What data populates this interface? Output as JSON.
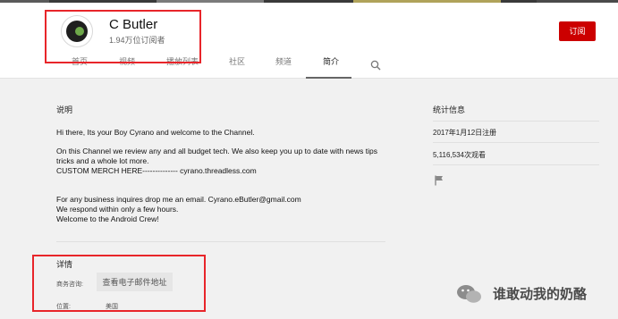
{
  "channel": {
    "name": "C Butler",
    "subscribers": "1.94万位订阅者",
    "subscribe_label": "订阅"
  },
  "tabs": [
    {
      "label": "首页"
    },
    {
      "label": "视频"
    },
    {
      "label": "播放列表"
    },
    {
      "label": "社区"
    },
    {
      "label": "频道"
    },
    {
      "label": "简介",
      "active": true
    }
  ],
  "about": {
    "title": "说明",
    "description": [
      "Hi there, Its your Boy Cyrano and welcome to the Channel.",
      "On this Channel we review any and all budget tech. We also keep you up to date with news tips tricks and a whole lot more.",
      " CUSTOM MERCH HERE-------------- cyrano.threadless.com",
      "For any business inquires drop me an email.  Cyrano.eButler@gmail.com",
      "We respond within only a few hours.",
      "Welcome to the Android Crew!"
    ],
    "details_title": "详情",
    "business_label": "商务咨询:",
    "email_button_label": "查看电子邮件地址",
    "location_label": "位置:",
    "location_value": "美国"
  },
  "stats": {
    "title": "统计信息",
    "joined": "2017年1月12日注册",
    "views": "5,116,534次观看"
  },
  "watermark": {
    "text": "谁敢动我的奶酪"
  },
  "colors": {
    "subscribe": "#cc0000",
    "highlight": "#e8252a"
  }
}
